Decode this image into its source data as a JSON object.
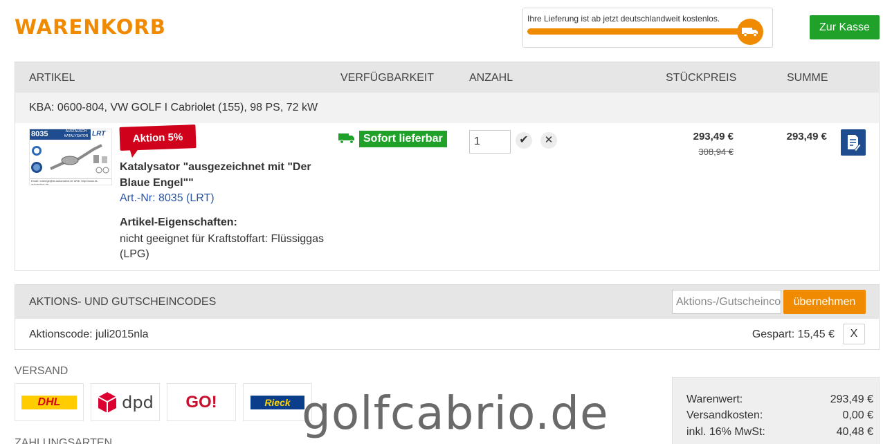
{
  "header": {
    "title": "WARENKORB",
    "delivery_message": "Ihre Lieferung ist ab jetzt deutschlandweit kostenlos.",
    "delivery_progress": 1.0,
    "delivery_icon": "truck-icon",
    "checkout_label": "Zur Kasse"
  },
  "cart": {
    "columns": {
      "article": "ARTIKEL",
      "availability": "VERFÜGBARKEIT",
      "quantity": "ANZAHL",
      "unit_price": "STÜCKPREIS",
      "sum": "SUMME"
    },
    "vehicle": "KBA: 0600-804, VW GOLF I Cabriolet (155), 98 PS, 72 kW",
    "item": {
      "image": {
        "number": "8035",
        "band_text": "AUSTAUSCH KATALYSATOR",
        "brand": "LRT",
        "footer_text": "Email: ordnege@lrt-automotive.de   Web: http://www.lrt-automotive.de"
      },
      "promo_badge": "Aktion 5%",
      "name": "Katalysator \"ausgezeichnet mit \"Der Blaue Engel\"\"",
      "art_nr": "Art.-Nr: 8035 (LRT)",
      "properties_title": "Artikel-Eigenschaften:",
      "properties_value": "nicht geeignet für Kraftstoffart: Flüssiggas (LPG)",
      "availability": "Sofort lieferbar",
      "quantity": "1",
      "confirm_symbol": "✔",
      "remove_symbol": "✕",
      "unit_price": "293,49 €",
      "old_price": "308,94 €",
      "sum": "293,49 €"
    }
  },
  "coupon": {
    "title": "AKTIONS- UND GUTSCHEINCODES",
    "placeholder": "Aktions-/Gutscheincode",
    "apply_label": "übernehmen",
    "code_text": "Aktionscode: juli2015nla",
    "saved_text": "Gespart: 15,45 €",
    "remove_label": "X"
  },
  "shipping": {
    "title": "VERSAND",
    "carriers": [
      "DHL",
      "dpd",
      "GO!",
      "Rieck"
    ]
  },
  "payment": {
    "title": "ZAHLUNGSARTEN"
  },
  "watermark": "golfcabrio.de",
  "totals": [
    {
      "label": "Warenwert:",
      "value": "293,49  €"
    },
    {
      "label": "Versandkosten:",
      "value": "0,00  €"
    },
    {
      "label": "inkl. 16% MwSt:",
      "value": "40,48  €"
    }
  ],
  "colors": {
    "accent": "#f08a00",
    "green": "#1fa12a",
    "promo_red": "#d0021b",
    "link_blue": "#2a56a3",
    "brand_blue": "#1f4c8f"
  }
}
